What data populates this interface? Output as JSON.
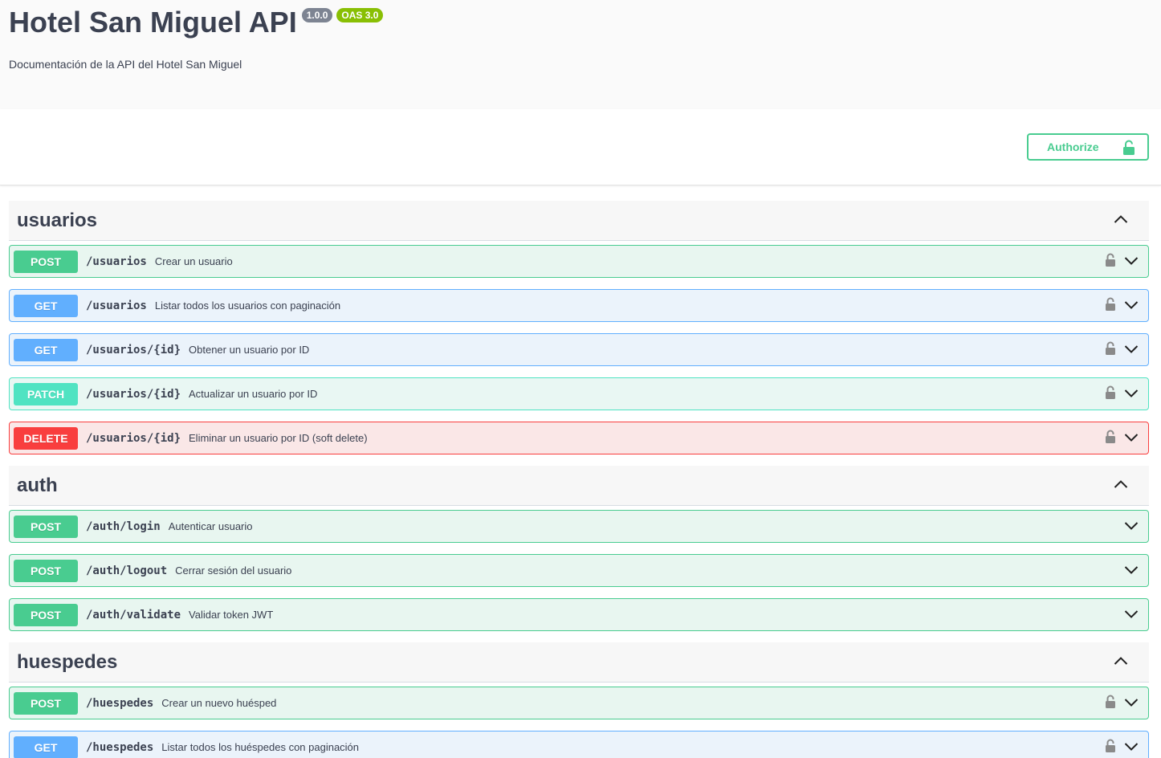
{
  "info": {
    "title": "Hotel San Miguel API",
    "version": "1.0.0",
    "oas": "OAS 3.0",
    "description": "Documentación de la API del Hotel San Miguel"
  },
  "authorize": {
    "label": "Authorize"
  },
  "tags": [
    {
      "name": "usuarios",
      "operations": [
        {
          "method": "POST",
          "path": "/usuarios",
          "summary": "Crear un usuario",
          "locked": true
        },
        {
          "method": "GET",
          "path": "/usuarios",
          "summary": "Listar todos los usuarios con paginación",
          "locked": true
        },
        {
          "method": "GET",
          "path": "/usuarios/{id}",
          "summary": "Obtener un usuario por ID",
          "locked": true
        },
        {
          "method": "PATCH",
          "path": "/usuarios/{id}",
          "summary": "Actualizar un usuario por ID",
          "locked": true
        },
        {
          "method": "DELETE",
          "path": "/usuarios/{id}",
          "summary": "Eliminar un usuario por ID (soft delete)",
          "locked": true
        }
      ]
    },
    {
      "name": "auth",
      "operations": [
        {
          "method": "POST",
          "path": "/auth/login",
          "summary": "Autenticar usuario",
          "locked": false
        },
        {
          "method": "POST",
          "path": "/auth/logout",
          "summary": "Cerrar sesión del usuario",
          "locked": false
        },
        {
          "method": "POST",
          "path": "/auth/validate",
          "summary": "Validar token JWT",
          "locked": false
        }
      ]
    },
    {
      "name": "huespedes",
      "operations": [
        {
          "method": "POST",
          "path": "/huespedes",
          "summary": "Crear un nuevo huésped",
          "locked": true
        },
        {
          "method": "GET",
          "path": "/huespedes",
          "summary": "Listar todos los huéspedes con paginación",
          "locked": true
        }
      ]
    }
  ],
  "colors": {
    "post": "#49cc90",
    "get": "#61affe",
    "patch": "#50e3c2",
    "delete": "#f93e3e"
  },
  "icons": {
    "lock": "lock-icon",
    "chevron_down": "chevron-down-icon",
    "chevron_up": "chevron-up-icon"
  }
}
